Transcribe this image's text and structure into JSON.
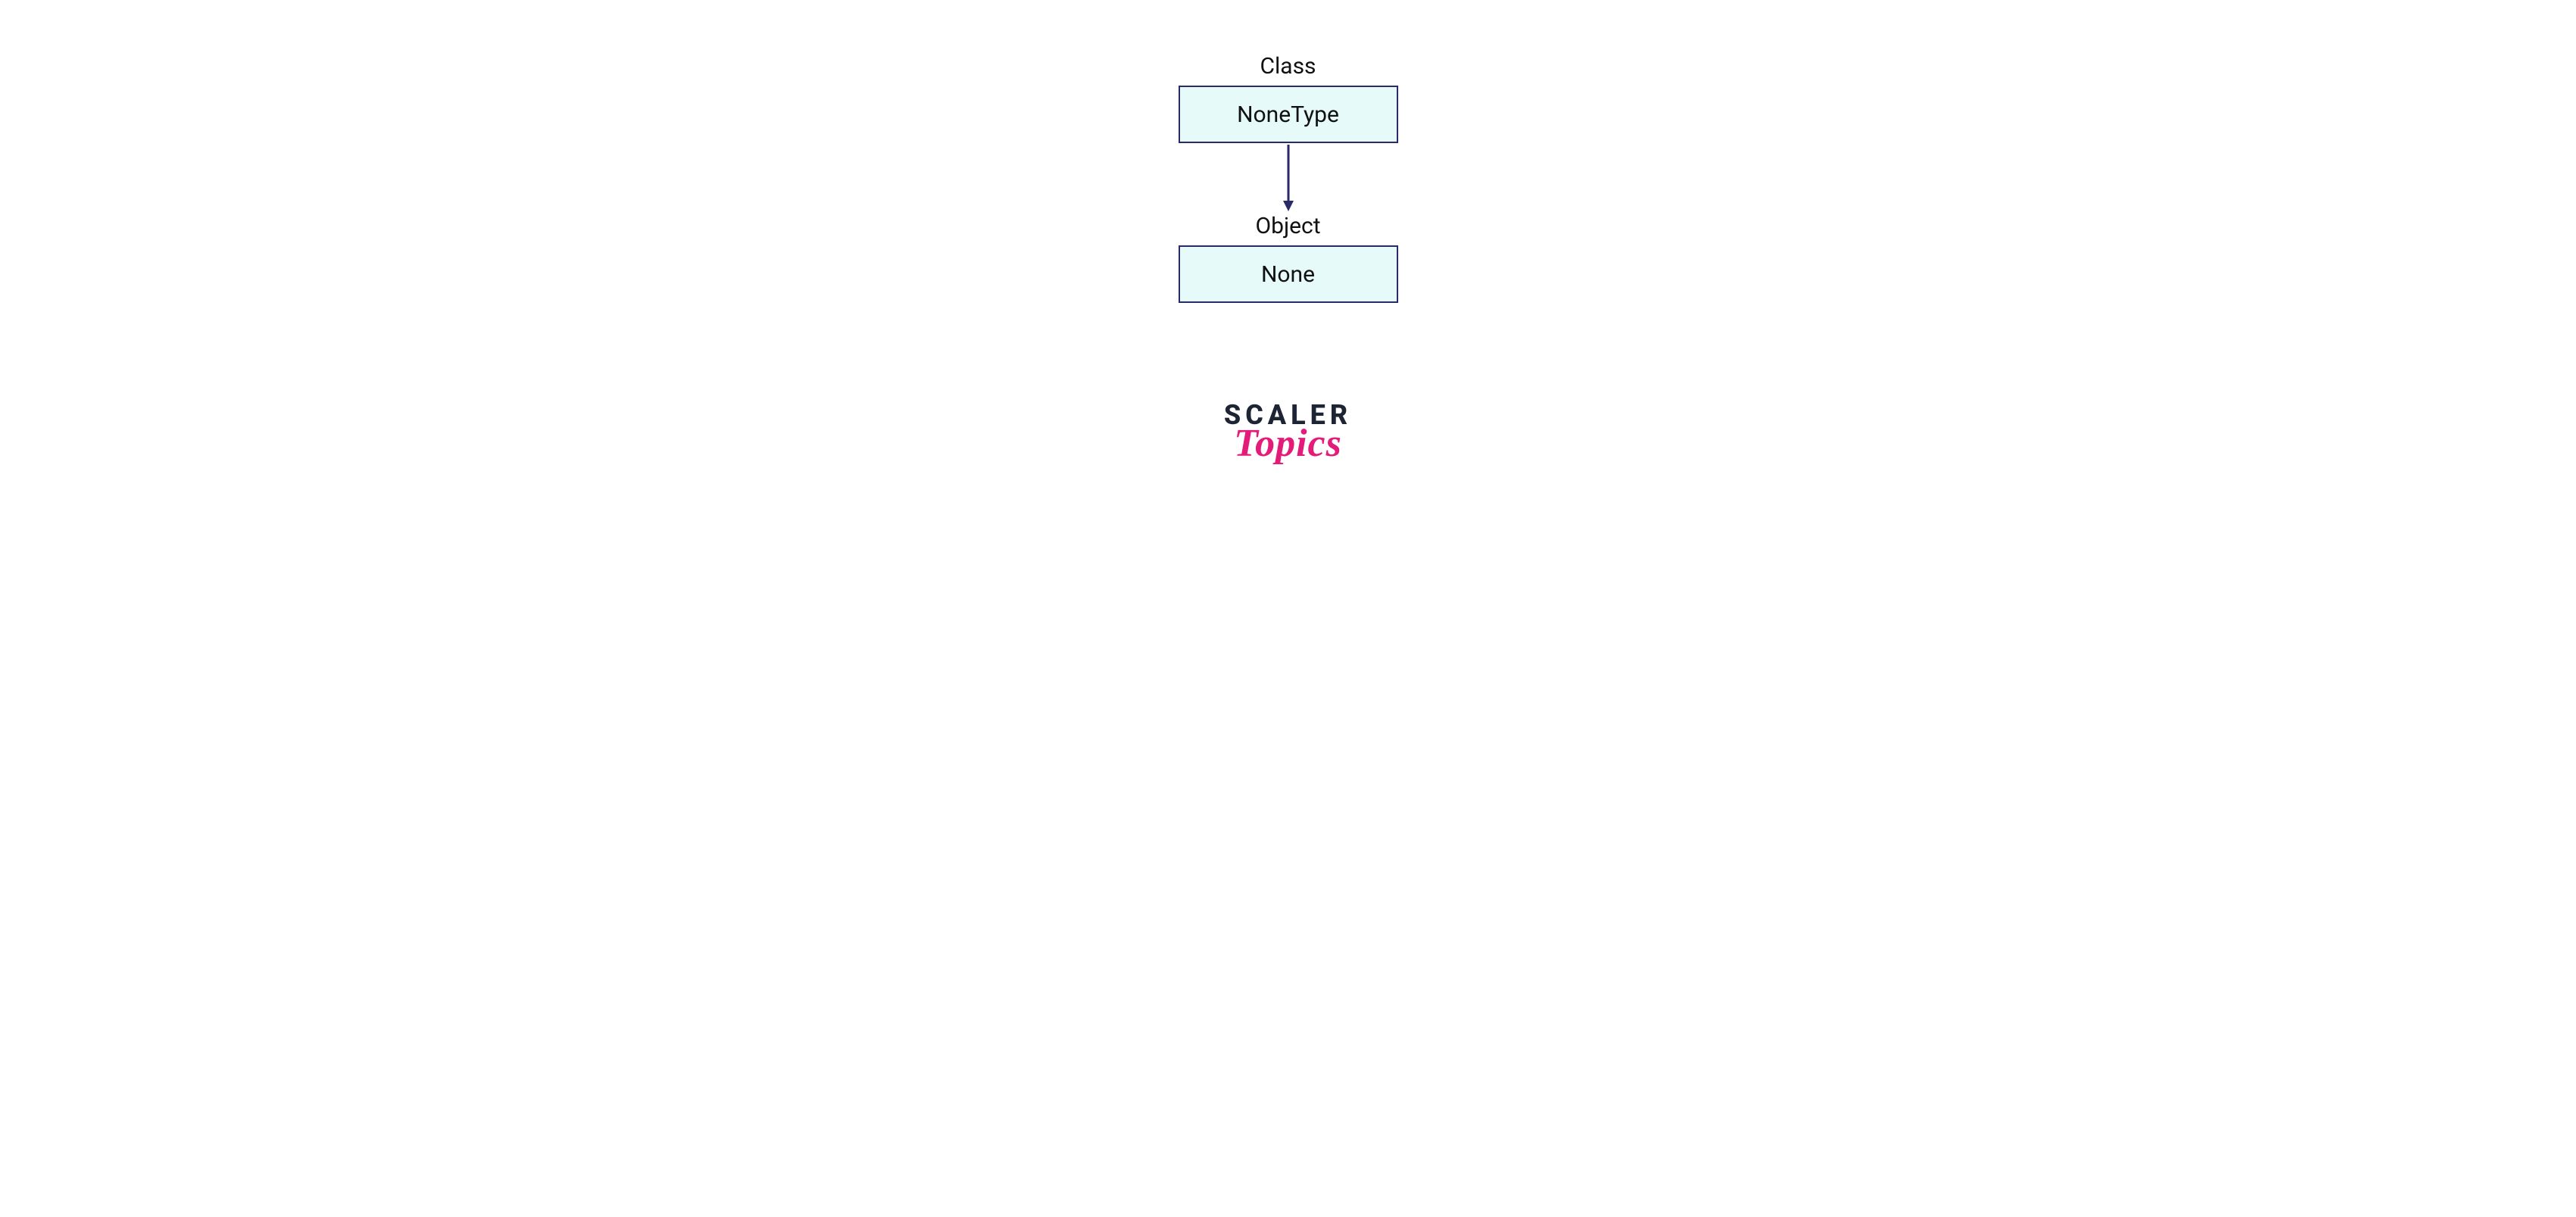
{
  "diagram": {
    "top_label": "Class",
    "top_box": "NoneType",
    "bottom_label": "Object",
    "bottom_box": "None"
  },
  "logo": {
    "line1": "SCALER",
    "line2": "Topics"
  },
  "colors": {
    "box_border": "#2a2a69",
    "box_fill": "#e6faf9",
    "arrow": "#2a2a69",
    "logo_dark": "#1d2433",
    "logo_pink": "#e31c79"
  }
}
